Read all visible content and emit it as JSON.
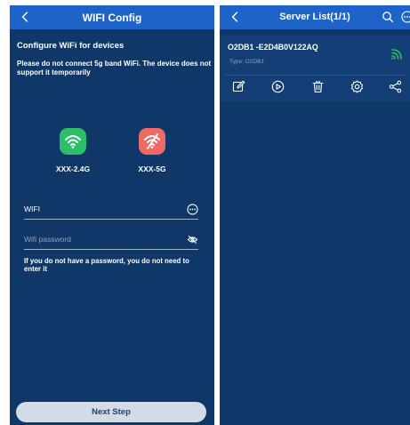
{
  "wifi_config": {
    "title": "WIFI Config",
    "heading": "Configure WiFi for devices",
    "warning": "Please do not connect 5g band WiFi. The device does not support it temporarily",
    "bands": [
      {
        "label": "XXX-2.4G",
        "icon": "wifi-icon",
        "color": "#2dbf68"
      },
      {
        "label": "XXX-5G",
        "icon": "wifi-off-icon",
        "color": "#ee6a64"
      }
    ],
    "ssid": {
      "value": "WIFI"
    },
    "password": {
      "placeholder": "Wifi password"
    },
    "hint": "If you do not have a password, you do not need to enter it",
    "next_label": "Next Step"
  },
  "server_list": {
    "title": "Server List(1/1)",
    "servers": [
      {
        "name": "O2DB1 -E2D4B0V122AQ",
        "type": "Type: O2DB1"
      }
    ],
    "actions": [
      "edit-icon",
      "play-icon",
      "delete-icon",
      "settings-icon",
      "share-icon"
    ]
  },
  "colors": {
    "background": "#0f3768",
    "header": "#1e64c8",
    "card": "#143f76",
    "signal": "#31c254",
    "button": "#d3dbe7"
  }
}
